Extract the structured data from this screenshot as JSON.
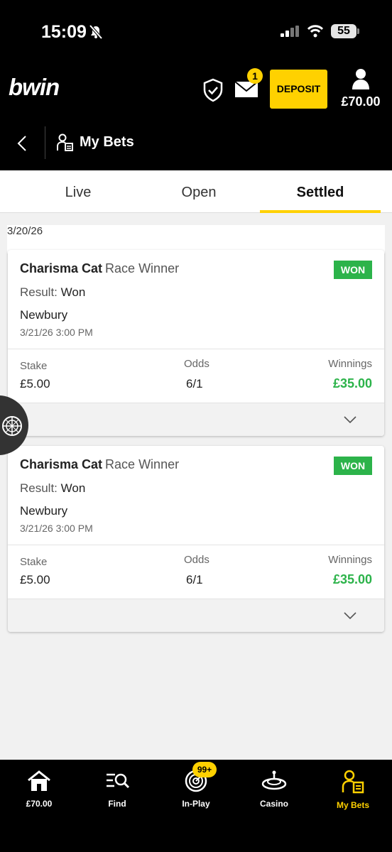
{
  "status_bar": {
    "time": "15:09",
    "battery": "55"
  },
  "header": {
    "logo": "bwin",
    "mail_badge": "1",
    "deposit_label": "DEPOSIT",
    "balance": "£70.00"
  },
  "subheader": {
    "title": "My Bets"
  },
  "tabs": [
    {
      "label": "Live",
      "active": false
    },
    {
      "label": "Open",
      "active": false
    },
    {
      "label": "Settled",
      "active": true
    }
  ],
  "group_date": "3/20/26",
  "bets": [
    {
      "selection": "Charisma Cat",
      "market": "Race Winner",
      "status": "WON",
      "result_label": "Result:",
      "result": "Won",
      "event": "Newbury",
      "event_time": "3/21/26 3:00 PM",
      "stake_label": "Stake",
      "stake": "£5.00",
      "odds_label": "Odds",
      "odds": "6/1",
      "winnings_label": "Winnings",
      "winnings": "£35.00"
    },
    {
      "selection": "Charisma Cat",
      "market": "Race Winner",
      "status": "WON",
      "result_label": "Result:",
      "result": "Won",
      "event": "Newbury",
      "event_time": "3/21/26 3:00 PM",
      "stake_label": "Stake",
      "stake": "£5.00",
      "odds_label": "Odds",
      "odds": "6/1",
      "winnings_label": "Winnings",
      "winnings": "£35.00"
    }
  ],
  "bottom_nav": {
    "home": "£70.00",
    "find": "Find",
    "inplay": "In-Play",
    "inplay_badge": "99+",
    "casino": "Casino",
    "mybets": "My Bets"
  },
  "colors": {
    "accent": "#ffd100",
    "won": "#2cb34a",
    "header_bg": "#000000"
  }
}
